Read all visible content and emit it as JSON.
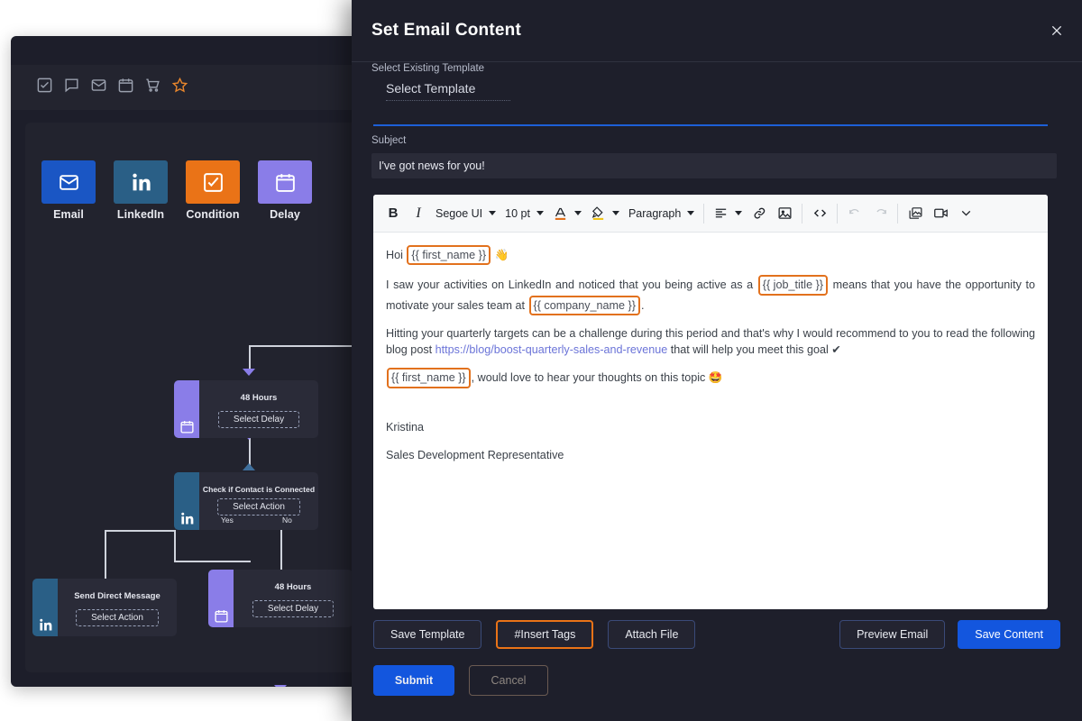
{
  "background_app": {
    "toolbar_icons": [
      "checkbox-icon",
      "comment-icon",
      "mail-icon",
      "calendar-icon",
      "cart-icon",
      "star-icon"
    ],
    "palette": [
      {
        "label": "Email",
        "icon": "mail-icon",
        "color": "#1a56c4"
      },
      {
        "label": "LinkedIn",
        "icon": "linkedin-icon",
        "color": "#2a5f86"
      },
      {
        "label": "Condition",
        "icon": "checkbox-icon",
        "color": "#ea7317"
      },
      {
        "label": "Delay",
        "icon": "calendar-icon",
        "color": "#8a7de8"
      }
    ],
    "nodes": [
      {
        "title": "48 Hours",
        "button": "Select Delay",
        "icon": "calendar-icon",
        "type": "delay"
      },
      {
        "title": "Check if Contact is Connected",
        "button": "Select Action",
        "icon": "linkedin-icon",
        "type": "linkedin",
        "yes_label": "Yes",
        "no_label": "No"
      },
      {
        "title": "Send Direct Message",
        "button": "Select Action",
        "icon": "linkedin-icon",
        "type": "linkedin"
      },
      {
        "title": "48 Hours",
        "button": "Select Delay",
        "icon": "calendar-icon",
        "type": "delay"
      }
    ]
  },
  "modal": {
    "title": "Set Email Content",
    "close_icon": "close-icon",
    "template": {
      "label": "Select Existing Template",
      "selected": "Select Template"
    },
    "subject": {
      "label": "Subject",
      "value": "I've got news for you!"
    },
    "toolbar": {
      "bold": "B",
      "italic": "I",
      "font_family": "Segoe UI",
      "font_size": "10 pt",
      "text_color_icon": "text-color-icon",
      "highlight_icon": "highlight-color-icon",
      "block_format": "Paragraph",
      "align_icon": "align-left-icon",
      "link_icon": "link-icon",
      "image_icon": "image-icon",
      "code_icon": "source-code-icon",
      "undo_icon": "undo-icon",
      "redo_icon": "redo-icon",
      "gallery_icon": "image-gallery-icon",
      "video_icon": "video-icon",
      "more_icon": "chevron-down-icon"
    },
    "body": {
      "greeting_prefix": "Hoi ",
      "greeting_tag": "{{ first_name }}",
      "greeting_emoji": "👋",
      "p2_a": "I saw your activities on LinkedIn and noticed that you being active as a ",
      "p2_tag1": "{{ job_title }}",
      "p2_b": " means that you have the opportunity to motivate your sales team at ",
      "p2_tag2": "{{ company_name }}",
      "p2_c": ".",
      "p3_a": "Hitting your quarterly targets can be a challenge during this period and that's why I would recommend to you to read the following blog post ",
      "p3_link": "https://blog/boost-quarterly-sales-and-revenue",
      "p3_b": " that will help you meet this goal ",
      "p3_emoji": "✔",
      "p4_tag": "{{ first_name }}",
      "p4_text": ", would love to hear your thoughts on this topic ",
      "p4_emoji": "🤩",
      "sig_name": "Kristina",
      "sig_role": "Sales Development Representative"
    },
    "actions": {
      "save_template": "Save Template",
      "insert_tags": "#Insert Tags",
      "attach_file": "Attach File",
      "preview_email": "Preview Email",
      "save_content": "Save Content",
      "submit": "Submit",
      "cancel": "Cancel"
    }
  },
  "colors": {
    "accent_blue": "#1356de",
    "accent_orange": "#ea7317",
    "purple": "#8a7de8",
    "linkedin_blue": "#2a5f86",
    "modal_bg": "#1e1f2b"
  }
}
